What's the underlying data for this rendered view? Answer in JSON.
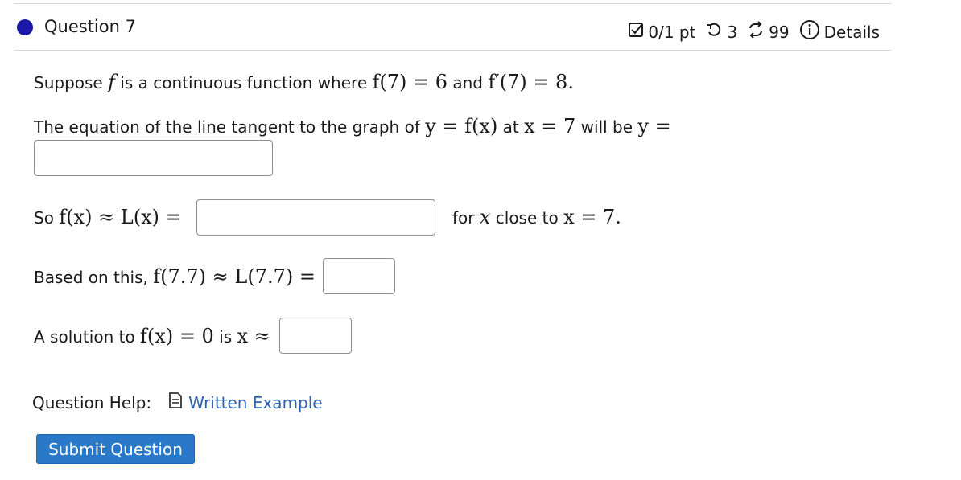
{
  "question": {
    "title": "Question 7"
  },
  "stats": {
    "score": "0/1 pt",
    "retries": "3",
    "attempts": "99",
    "details": "Details"
  },
  "line1": {
    "suppose": "Suppose",
    "f": "f",
    "text_continuous": "is a continuous function where",
    "expr1": "f(7) = 6",
    "and": "and",
    "expr2": "f′(7) = 8."
  },
  "line2": {
    "text": "The equation of the line tangent to the graph of",
    "expr_y": "y = f(x)",
    "at": "at",
    "expr_x": "x = 7",
    "will_be": "will be",
    "expr_yeq": "y ="
  },
  "line3": {
    "so": "So",
    "expr": "f(x) ≈ L(x) =",
    "for": "for",
    "x": "x",
    "close_to": "close to",
    "expr_x": "x = 7."
  },
  "line4": {
    "based": "Based on this,",
    "expr": "f(7.7) ≈ L(7.7) ="
  },
  "line5": {
    "a_solution": "A solution to",
    "expr": "f(x) = 0",
    "is": "is",
    "expr2": "x ≈"
  },
  "help": {
    "label": "Question Help:",
    "link": "Written Example",
    "icon": "document-icon"
  },
  "submit": {
    "label": "Submit Question"
  },
  "colors": {
    "accent": "#2a78c8",
    "dot": "#1a1aa6",
    "link": "#2f63b0"
  }
}
